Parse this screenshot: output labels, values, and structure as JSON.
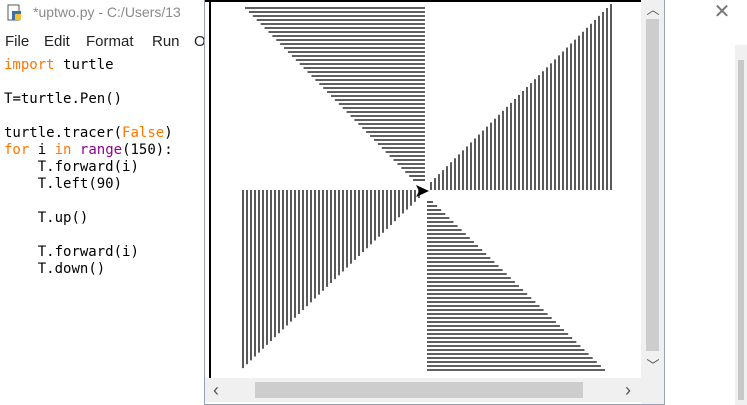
{
  "window": {
    "title": "*uptwo.py - C:/Users/13",
    "close_glyph": "✕"
  },
  "menu": [
    {
      "label": "File"
    },
    {
      "label": "Edit"
    },
    {
      "label": "Format"
    },
    {
      "label": "Run"
    },
    {
      "label": "O"
    }
  ],
  "code_lines": [
    "import turtle",
    "",
    "T=turtle.Pen()",
    "",
    "turtle.tracer(False)",
    "for i in range(150):",
    "    T.forward(i)",
    "    T.left(90)",
    "",
    "    T.up()",
    "",
    "    T.forward(i)",
    "    T.down()"
  ],
  "turtle_window": {
    "scroll_up_arrow": "︿",
    "scroll_down_arrow": "﹀",
    "scroll_left_arrow": "‹",
    "scroll_right_arrow": "›"
  },
  "colors": {
    "keyword": "#ff7700",
    "builtin": "#900090",
    "lines": "#000000"
  }
}
